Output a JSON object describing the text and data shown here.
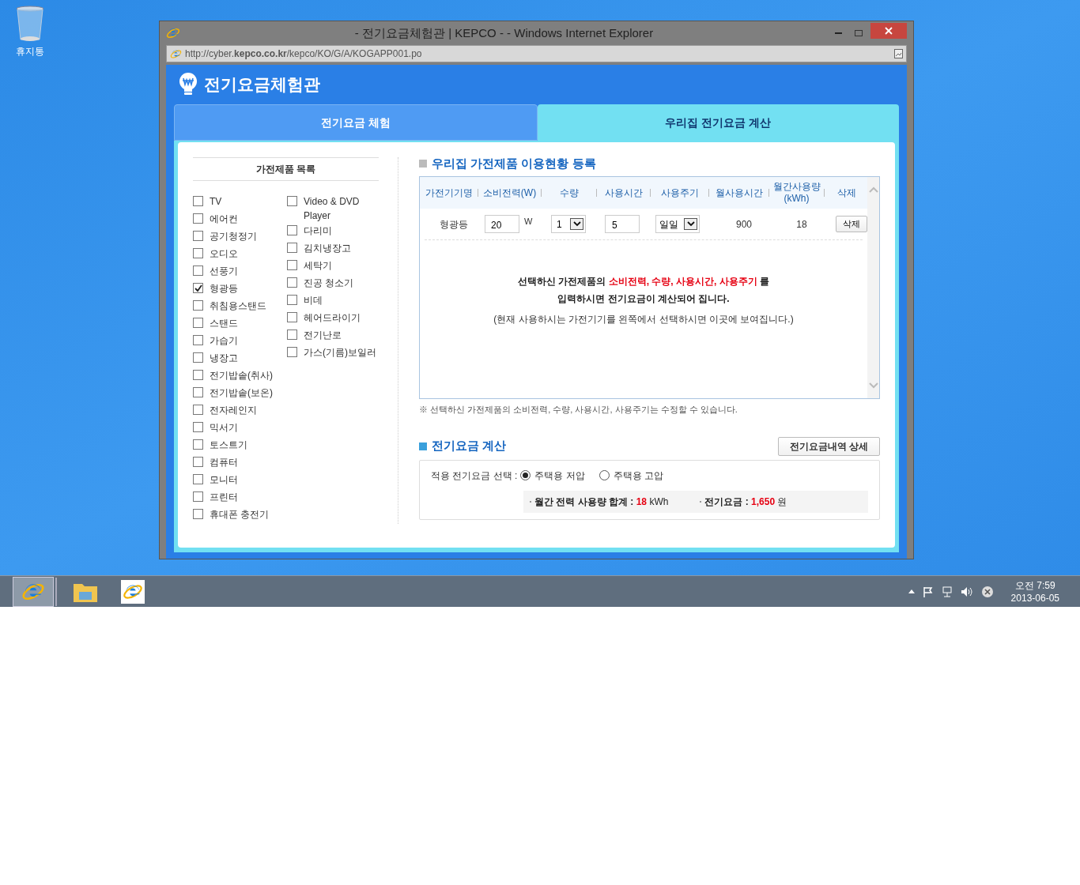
{
  "desktop_icons": [
    {
      "label": "휴지통"
    }
  ],
  "window": {
    "title": "- 전기요금체험관 | KEPCO - - Windows Internet Explorer",
    "address": "http://cyber.**kepco.co.kr**/kepco/KO/G/A/KOGAPP001.po"
  },
  "page": {
    "title": "전기요금체험관"
  },
  "tabs": [
    {
      "label": "전기요금 체험",
      "selected": false
    },
    {
      "label": "우리집 전기요금 계산",
      "selected": true
    }
  ],
  "appliance_list": {
    "title": "가전제품 목록",
    "columns": [
      {
        "items": [
          {
            "label": "TV",
            "checked": false
          },
          {
            "label": "에어컨",
            "checked": false
          },
          {
            "label": "공기청정기",
            "checked": false
          },
          {
            "label": "오디오",
            "checked": false
          },
          {
            "label": "선풍기",
            "checked": false
          },
          {
            "label": "형광등",
            "checked": true
          },
          {
            "label": "취침용스탠드",
            "checked": false
          },
          {
            "label": "스탠드",
            "checked": false
          },
          {
            "label": "가습기",
            "checked": false
          },
          {
            "label": "냉장고",
            "checked": false
          },
          {
            "label": "전기밥솥(취사)",
            "checked": false
          },
          {
            "label": "전기밥솥(보온)",
            "checked": false
          },
          {
            "label": "전자레인지",
            "checked": false
          },
          {
            "label": "믹서기",
            "checked": false
          },
          {
            "label": "토스트기",
            "checked": false
          },
          {
            "label": "컴퓨터",
            "checked": false
          },
          {
            "label": "모니터",
            "checked": false
          },
          {
            "label": "프린터",
            "checked": false
          },
          {
            "label": "휴대폰 충전기",
            "checked": false
          }
        ]
      },
      {
        "items": [
          {
            "label": "Video & DVD Player",
            "checked": false
          },
          {
            "label": "다리미",
            "checked": false
          },
          {
            "label": "김치냉장고",
            "checked": false
          },
          {
            "label": "세탁기",
            "checked": false
          },
          {
            "label": "진공 청소기",
            "checked": false
          },
          {
            "label": "비데",
            "checked": false
          },
          {
            "label": "헤어드라이기",
            "checked": false
          },
          {
            "label": "전기난로",
            "checked": false
          },
          {
            "label": "가스(기름)보일러",
            "checked": false
          }
        ]
      }
    ]
  },
  "registration": {
    "title": "우리집 가전제품 이용현황 등록",
    "columns": [
      "가전기기명",
      "소비전력(W)",
      "수량",
      "사용시간",
      "사용주기",
      "월사용시간",
      "월간사용량\n(kWh)",
      "삭제"
    ],
    "rows": [
      {
        "name": "형광등",
        "power": "20",
        "power_unit": "W",
        "quantity": "1",
        "hours": "5",
        "cycle": "일일",
        "monthly_hours": "900",
        "monthly_kwh": "18",
        "delete": "삭제"
      }
    ],
    "message": [
      [
        {
          "text": "선택하신 가전제품의 ",
          "highlight": false
        },
        {
          "text": "소비전력, 수량, 사용시간, 사용주기",
          "highlight": true
        },
        {
          "text": " 를",
          "highlight": false
        }
      ],
      [
        {
          "text": "입력하시면 전기요금이 계산되어 집니다.",
          "highlight": false
        }
      ]
    ],
    "hint": "(현재 사용하시는 가전기기를 왼쪽에서 선택하시면 이곳에 보여집니다.)",
    "note": "※ 선택하신 가전제품의 소비전력, 수량, 사용시간, 사용주기는 수정할 수 있습니다."
  },
  "calculation": {
    "title": "전기요금 계산",
    "detail_button": "전기요금내역 상세",
    "rate_label": "적용 전기요금 선택 :",
    "rates": [
      {
        "label": "주택용 저압",
        "selected": true
      },
      {
        "label": "주택용 고압",
        "selected": false
      }
    ],
    "summary": [
      {
        "label": "월간 전력 사용량 합계 :",
        "value": "18",
        "unit": "kWh"
      },
      {
        "label": "전기요금 :",
        "value": "1,650",
        "unit": "원"
      }
    ]
  },
  "taskbar": {
    "clock_time": "오전 7:59",
    "clock_date": "2013-06-05"
  }
}
